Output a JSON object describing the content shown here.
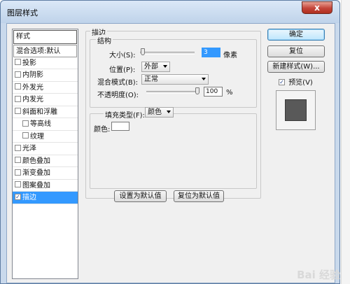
{
  "window": {
    "title": "图层样式",
    "close_label": "x"
  },
  "style_list": {
    "header": "样式",
    "items": [
      {
        "label": "混合选项:默认",
        "has_checkbox": false,
        "checked": false,
        "sub": false
      },
      {
        "label": "投影",
        "has_checkbox": true,
        "checked": false,
        "sub": false
      },
      {
        "label": "内阴影",
        "has_checkbox": true,
        "checked": false,
        "sub": false
      },
      {
        "label": "外发光",
        "has_checkbox": true,
        "checked": false,
        "sub": false
      },
      {
        "label": "内发光",
        "has_checkbox": true,
        "checked": false,
        "sub": false
      },
      {
        "label": "斜面和浮雕",
        "has_checkbox": true,
        "checked": false,
        "sub": false
      },
      {
        "label": "等高线",
        "has_checkbox": true,
        "checked": false,
        "sub": true
      },
      {
        "label": "纹理",
        "has_checkbox": true,
        "checked": false,
        "sub": true
      },
      {
        "label": "光泽",
        "has_checkbox": true,
        "checked": false,
        "sub": false
      },
      {
        "label": "颜色叠加",
        "has_checkbox": true,
        "checked": false,
        "sub": false
      },
      {
        "label": "渐变叠加",
        "has_checkbox": true,
        "checked": false,
        "sub": false
      },
      {
        "label": "图案叠加",
        "has_checkbox": true,
        "checked": false,
        "sub": false
      },
      {
        "label": "描边",
        "has_checkbox": true,
        "checked": true,
        "sub": false,
        "selected": true
      }
    ]
  },
  "stroke": {
    "group_title": "描边",
    "structure_title": "结构",
    "size_label": "大小(S):",
    "size_value": "3",
    "size_unit": "像素",
    "position_label": "位置(P):",
    "position_value": "外部",
    "blend_label": "混合模式(B):",
    "blend_value": "正常",
    "opacity_label": "不透明度(O):",
    "opacity_value": "100",
    "opacity_unit": "%",
    "fill_type_label": "填充类型(F):",
    "fill_type_value": "颜色",
    "color_label": "颜色:"
  },
  "buttons": {
    "ok": "确定",
    "reset": "复位",
    "new_style": "新建样式(W)...",
    "preview_label": "预览(V)",
    "preview_checked": true,
    "make_default": "设置为默认值",
    "reset_default": "复位为默认值"
  },
  "watermark": "Bai 经验"
}
